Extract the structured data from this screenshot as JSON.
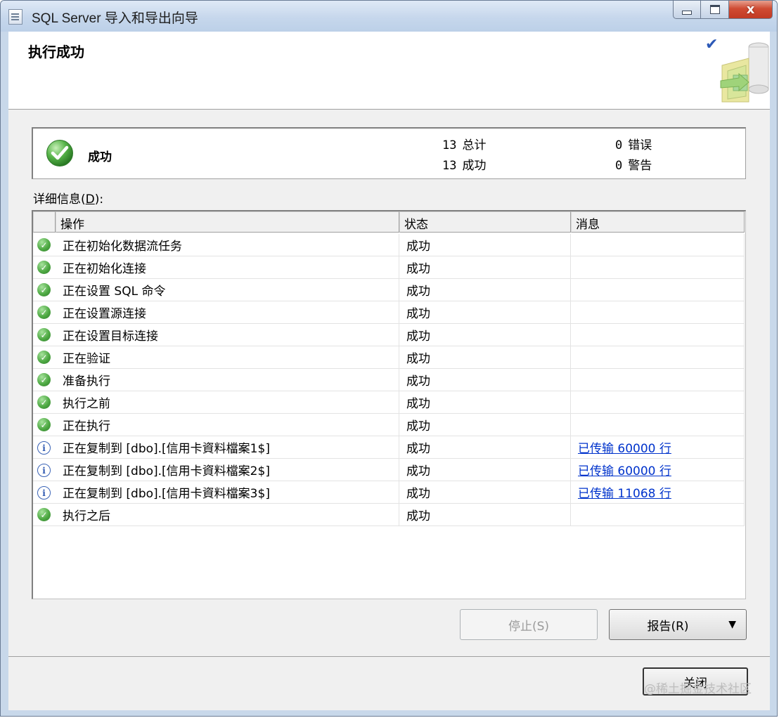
{
  "window": {
    "title": "SQL Server 导入和导出向导",
    "minimize_glyph": "",
    "close_glyph": "x"
  },
  "header": {
    "title": "执行成功",
    "check_glyph": "✔"
  },
  "summary": {
    "status": "成功",
    "total_count": "13",
    "total_label": "总计",
    "success_count": "13",
    "success_label": "成功",
    "error_count": "0",
    "error_label": "错误",
    "warning_count": "0",
    "warning_label": "警告"
  },
  "details": {
    "label_prefix": "详细信息(",
    "label_key": "D",
    "label_suffix": "):"
  },
  "grid": {
    "columns": [
      "操作",
      "状态",
      "消息"
    ],
    "rows": [
      {
        "icon": "success-icon",
        "action": "正在初始化数据流任务",
        "status": "成功",
        "message": ""
      },
      {
        "icon": "success-icon",
        "action": "正在初始化连接",
        "status": "成功",
        "message": ""
      },
      {
        "icon": "success-icon",
        "action": "正在设置 SQL 命令",
        "status": "成功",
        "message": ""
      },
      {
        "icon": "success-icon",
        "action": "正在设置源连接",
        "status": "成功",
        "message": ""
      },
      {
        "icon": "success-icon",
        "action": "正在设置目标连接",
        "status": "成功",
        "message": ""
      },
      {
        "icon": "success-icon",
        "action": "正在验证",
        "status": "成功",
        "message": ""
      },
      {
        "icon": "success-icon",
        "action": "准备执行",
        "status": "成功",
        "message": ""
      },
      {
        "icon": "success-icon",
        "action": "执行之前",
        "status": "成功",
        "message": ""
      },
      {
        "icon": "success-icon",
        "action": "正在执行",
        "status": "成功",
        "message": ""
      },
      {
        "icon": "info-icon",
        "action": "正在复制到 [dbo].[信用卡資料檔案1$]",
        "status": "成功",
        "message": "已传输 60000 行"
      },
      {
        "icon": "info-icon",
        "action": "正在复制到 [dbo].[信用卡資料檔案2$]",
        "status": "成功",
        "message": "已传输 60000 行"
      },
      {
        "icon": "info-icon",
        "action": "正在复制到 [dbo].[信用卡資料檔案3$]",
        "status": "成功",
        "message": "已传输 11068 行"
      },
      {
        "icon": "success-icon",
        "action": "执行之后",
        "status": "成功",
        "message": ""
      }
    ]
  },
  "buttons": {
    "stop": "停止(S)",
    "report": "报告(R)",
    "report_arrow": "▼",
    "close": "关闭"
  },
  "watermark": "@稀土掘金技术社区"
}
